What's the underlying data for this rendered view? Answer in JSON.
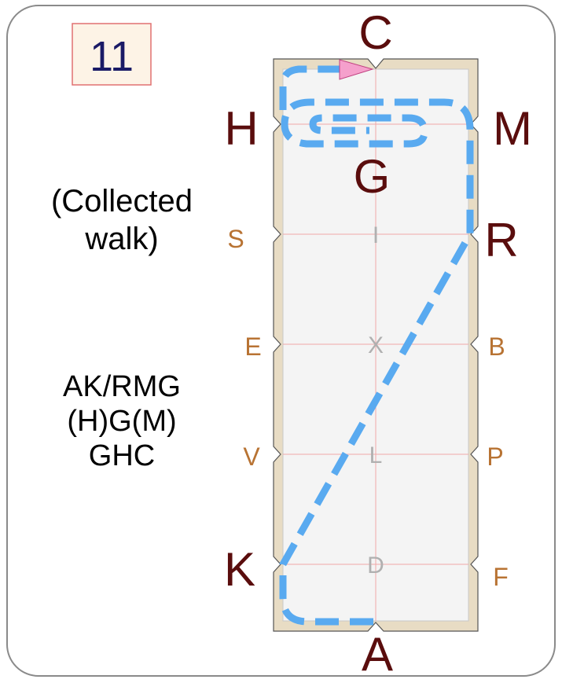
{
  "test_number": "11",
  "description": "(Collected walk)",
  "movements": [
    "AK/RMG",
    "(H)G(M)",
    "GHC"
  ],
  "letters": {
    "major": [
      "C",
      "H",
      "M",
      "G",
      "R",
      "K",
      "A"
    ],
    "minor": [
      "S",
      "E",
      "B",
      "V",
      "P",
      "F"
    ],
    "centerline": [
      "I",
      "X",
      "L",
      "D"
    ]
  },
  "colors": {
    "major_letter": "#5a0d0d",
    "minor_letter": "#b87333",
    "centerline_letter": "#b0b0b0",
    "path": "#59aaf0",
    "arena_border": "#e8dcc4",
    "arena_fill": "#f4f4f4",
    "grid_line": "#f0a8a8",
    "badge_fill": "#fdf3e6",
    "badge_border": "#e07070",
    "badge_text": "#1a1a66",
    "start_arrow": "#f5a0cc"
  },
  "path_style": "dashed"
}
